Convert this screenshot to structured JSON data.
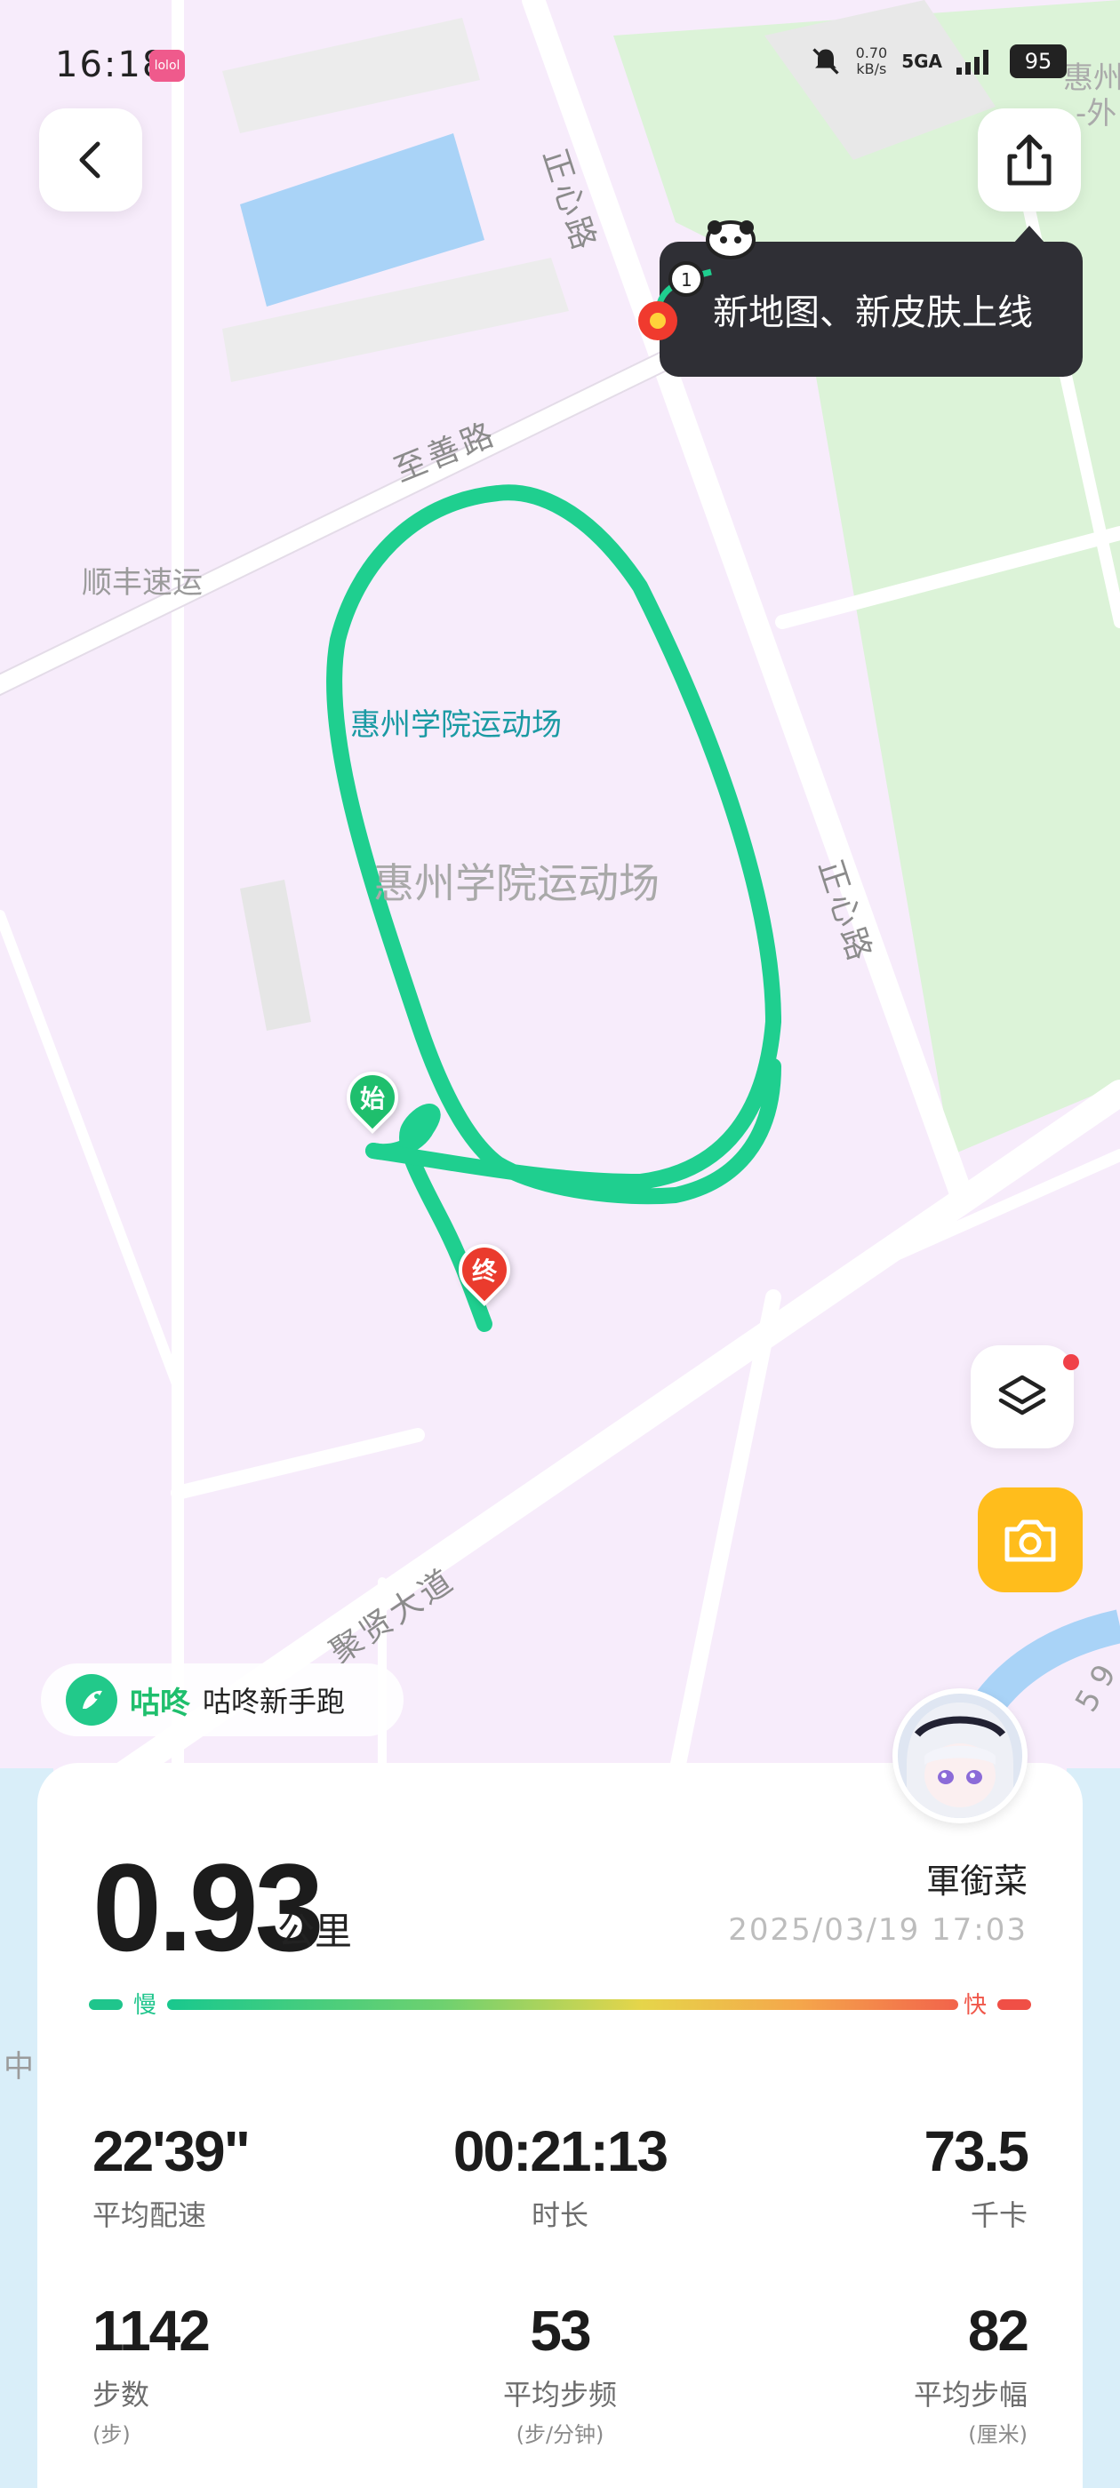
{
  "status_bar": {
    "time": "16:18",
    "app_badge": "lolol",
    "net_speed_value": "0.70",
    "net_speed_unit": "kB/s",
    "network": "5GA",
    "battery": "95"
  },
  "map": {
    "roads": {
      "zhengxin_road_top": "正心路",
      "zhishan_road": "至善路",
      "zhengxin_road_right": "正心路",
      "juxian_avenue": "聚贤大道"
    },
    "pois": {
      "shunfeng": "顺丰速运",
      "stadium_small": "惠州学院运动场",
      "stadium_big": "惠州学院运动场",
      "corner_top": "惠州",
      "corner_top2": "-外",
      "edge_left": "中",
      "edge_right": "5 9"
    },
    "markers": {
      "start": "始",
      "end": "终"
    },
    "track_color": "#1fcf8f"
  },
  "tooltip": {
    "text": "新地图、新皮肤上线"
  },
  "brand": {
    "name": "咕咚",
    "slogan": "咕咚新手跑"
  },
  "summary": {
    "distance": "0.93",
    "distance_unit": "公里",
    "username": "軍銜菜",
    "date": "2025/03/19 17:03",
    "pace_slow_label": "慢",
    "pace_fast_label": "快"
  },
  "stats": {
    "avg_pace": {
      "value": "22'39\"",
      "label": "平均配速"
    },
    "duration": {
      "value": "00:21:13",
      "label": "时长"
    },
    "calories": {
      "value": "73.5",
      "label": "千卡"
    },
    "steps": {
      "value": "1142",
      "label": "步数",
      "unit": "(步)"
    },
    "cadence": {
      "value": "53",
      "label": "平均步频",
      "unit": "(步/分钟)"
    },
    "stride": {
      "value": "82",
      "label": "平均步幅",
      "unit": "(厘米)"
    }
  },
  "colors": {
    "accent_green": "#1fcf8f",
    "camera_yellow": "#ffbd1c",
    "map_bg": "#f7ecfb",
    "park_green": "#dcf3d8"
  }
}
